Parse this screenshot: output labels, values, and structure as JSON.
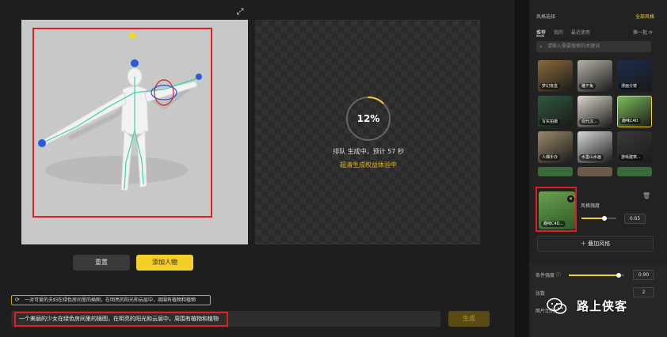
{
  "canvas": {
    "progress_percent": "12%",
    "progress_fraction": 0.12,
    "queue_status": "排队 生成中，预计 57 秒",
    "speed_hint": "超清生成权益体验中"
  },
  "buttons": {
    "reset": "重置",
    "add_person": "添加人物",
    "generate": "生成"
  },
  "prompt": {
    "suggestion": "一对可爱的夫妇在绿色房间里的插图，在明亮的阳光和云层中，周围有植物和植物",
    "value": "一个美丽的少女在绿色房间里的插图，在明亮的阳光和云层中，周围有植物和植物"
  },
  "style_panel": {
    "title": "风格选择",
    "all_styles": "全部风格",
    "tabs": [
      "推荐",
      "我的",
      "最近使用"
    ],
    "active_tab": "推荐",
    "refresh": "换一批",
    "search_placeholder": "请输入需要搜索的关键词",
    "thumbnails": [
      {
        "label": "梦幻盲盒",
        "color": "#8a6a3a"
      },
      {
        "label": "雕ヂ兔",
        "color": "#b7b3a8"
      },
      {
        "label": "漫画分镜",
        "color": "#1c2c4a"
      },
      {
        "label": "写实拍摄",
        "color": "#2e5a3a"
      },
      {
        "label": "现代汉...",
        "color": "#ddd8cc"
      },
      {
        "label": "趣味C4D",
        "color": "#7cbd5a",
        "selected": true
      },
      {
        "label": "人偶手办",
        "color": "#9a8a6a"
      },
      {
        "label": "水墨山水画",
        "color": "#d9d9d6"
      },
      {
        "label": "游戏建筑...",
        "color": "#3a3a3a"
      }
    ],
    "selected_style": {
      "label": "趣味C4D...",
      "strength_label": "风格强度",
      "strength_value": "0.65",
      "strength_fraction": 0.65
    },
    "add_style": "叠加风格",
    "condition": {
      "label": "条件强度",
      "value": "0.90",
      "fraction": 0.9
    },
    "count": {
      "label": "张数",
      "value": "2"
    },
    "ratio_label": "图片比例"
  },
  "watermark": {
    "text": "路上侠客"
  },
  "colors": {
    "accent": "#f4cf2a",
    "highlight_border": "#e02020",
    "bg": "#1e1e1e"
  }
}
